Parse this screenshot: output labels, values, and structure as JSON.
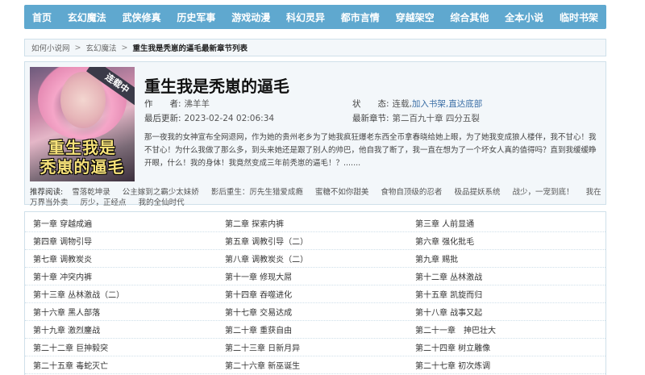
{
  "nav": {
    "items": [
      "首页",
      "玄幻魔法",
      "武侠修真",
      "历史军事",
      "游戏动漫",
      "科幻灵异",
      "都市言情",
      "穿越架空",
      "综合其他",
      "全本小说",
      "临时书架"
    ]
  },
  "breadcrumb": {
    "site": "如何小说网",
    "sep1": ">",
    "category": "玄幻魔法",
    "sep2": ">",
    "current": "重生我是秃崽的逼毛最新章节列表"
  },
  "book": {
    "cover_badge": "连载中",
    "cover_title_line1": "重生我是",
    "cover_title_line2": "秃崽的逼毛",
    "title": "重生我是秃崽的逼毛",
    "author_label": "作　　者:",
    "author": "沸羊羊",
    "status_label": "状　　态:",
    "status": "连载,",
    "add_shelf": "加入书架,",
    "goto_bottom": "直达底部",
    "updated_label": "最后更新:",
    "updated": "2023-02-24 02:06:34",
    "latest_label": "最新章节:",
    "latest": "第二百九十章 四分五裂",
    "intro": "那一夜我的女神宣布全网退网，作为她的贵州老乡为了她我疯狂爆老东西全币拿春晓给她上眼，为了她我变成狼人楼伴，我不甘心！我不甘心！为什么我做了那么多，到头来她还是跟了别人的帅巴，他自我了断了，我一直在想为了一个坏女人真的值得吗？直到我缓缓睁开眼，什么！我的身体！我竟然变成三年前秃崽的逼毛！？.......",
    "recommend_label": "推荐阅读:",
    "recommend": [
      "雪落乾坤录",
      "公主嫁到之霸少太妹娇",
      "影后重生：厉先生猎爱成瘾",
      "蜜糖不如你甜美",
      "食物自顶级的忍者",
      "极品提妖系统",
      "战少，一宠到底！",
      "我在万界当外卖",
      "厉少，正经点",
      "我的全仙时代"
    ]
  },
  "chapters": [
    [
      "第一章 穿越成遍",
      "第二章 探索内裤",
      "第三章 人前显通"
    ],
    [
      "第四章 调物引导",
      "第五章 调教引导（二）",
      "第六章 强化批毛"
    ],
    [
      "第七章 调教炭炎",
      "第八章 调教炭炎（二）",
      "第九章 赐批"
    ],
    [
      "第十章 冲突内裤",
      "第十一章 修现大屌",
      "第十二章 丛林激战"
    ],
    [
      "第十三章 丛林激战（二）",
      "第十四章 吞噬进化",
      "第十五章 凯旋而归"
    ],
    [
      "第十六章 黑人部落",
      "第十七章 交易达成",
      "第十八章 战事又起"
    ],
    [
      "第十九章 激烈鏖战",
      "第二十章 重获自由",
      "第二十一章　抻巴壮大"
    ],
    [
      "第二十二章 巨抻毅突",
      "第二十三章 日新月异",
      "第二十四章 树立雕像"
    ],
    [
      "第二十五章 毒蛇灭亡",
      "第二十六章 新巫诞生",
      "第二十七章 初次炼调"
    ]
  ]
}
